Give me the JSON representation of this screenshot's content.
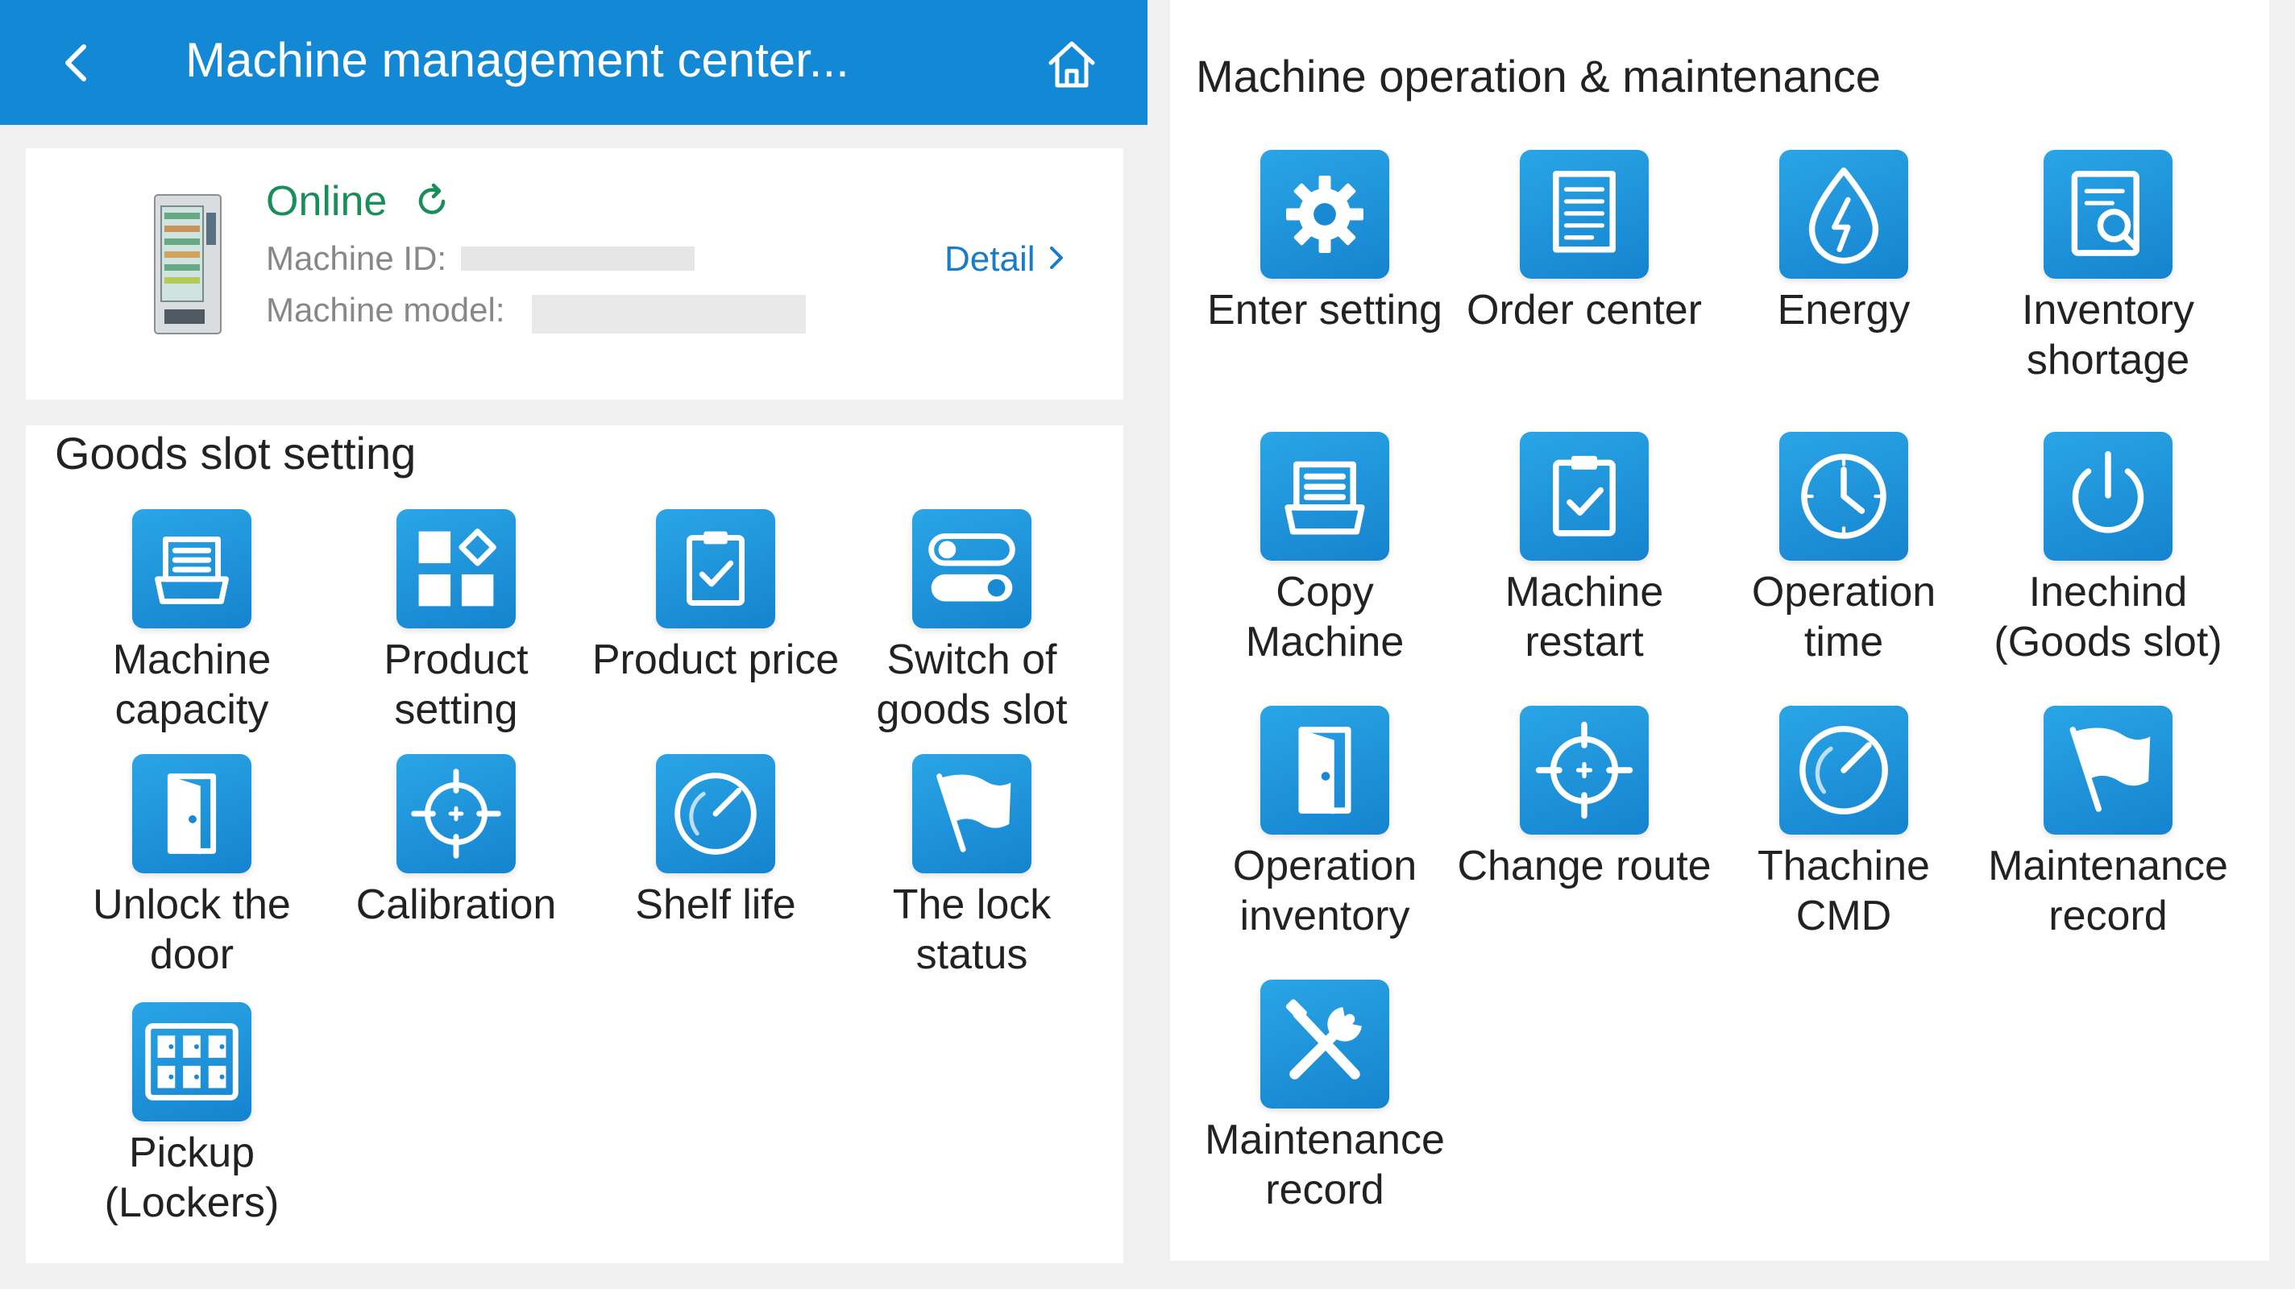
{
  "header": {
    "title": "Machine management center...",
    "background": "#1389d6"
  },
  "machine": {
    "status": "Online",
    "status_color": "#1a8e5a",
    "id_label": "Machine ID:",
    "model_label": "Machine model:",
    "detail_link": "Detail"
  },
  "goods_slot": {
    "title": "Goods slot setting",
    "items": [
      {
        "label": "Machine\ncapacity",
        "icon": "drawer-icon"
      },
      {
        "label": "Product\nsetting",
        "icon": "grid-diamond-icon"
      },
      {
        "label": "Product price",
        "icon": "clipboard-check-icon"
      },
      {
        "label": "Switch of\ngoods slot",
        "icon": "toggle-icon"
      },
      {
        "label": "Unlock the\ndoor",
        "icon": "door-icon"
      },
      {
        "label": "Calibration",
        "icon": "crosshair-icon"
      },
      {
        "label": "Shelf life",
        "icon": "gauge-icon"
      },
      {
        "label": "The lock\nstatus",
        "icon": "flag-icon"
      },
      {
        "label": "Pickup\n(Lockers)",
        "icon": "lockers-icon"
      }
    ]
  },
  "operations": {
    "title": "Machine operation & maintenance",
    "items": [
      {
        "label": "Enter setting",
        "icon": "gear-icon"
      },
      {
        "label": "Order center",
        "icon": "receipt-icon"
      },
      {
        "label": "Energy",
        "icon": "energy-drop-icon"
      },
      {
        "label": "Inventory\nshortage",
        "icon": "inventory-search-icon"
      },
      {
        "label": "Copy\nMachine",
        "icon": "drawer-icon"
      },
      {
        "label": "Machine\nrestart",
        "icon": "clipboard-check-icon"
      },
      {
        "label": "Operation\ntime",
        "icon": "clock-icon"
      },
      {
        "label": "Inechind\n(Goods slot)",
        "icon": "power-icon"
      },
      {
        "label": "Operation\ninventory",
        "icon": "door-icon"
      },
      {
        "label": "Change route",
        "icon": "crosshair-icon"
      },
      {
        "label": "Thachine\nCMD",
        "icon": "gauge-icon"
      },
      {
        "label": "Maintenance\nrecord",
        "icon": "flag-icon"
      },
      {
        "label": "Maintenance\nrecord",
        "icon": "tools-icon"
      }
    ]
  }
}
